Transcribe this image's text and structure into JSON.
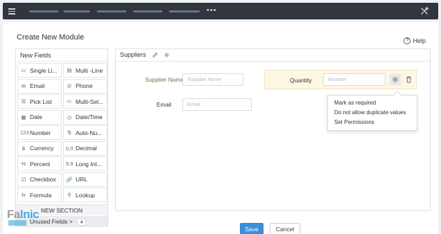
{
  "topbar": {
    "more": "•••"
  },
  "page": {
    "title": "Create New Module",
    "help": "Help",
    "help_glyph": "?"
  },
  "fields_panel": {
    "header": "New Fields",
    "items": [
      {
        "label": "Single Li...",
        "icon": "single-line-icon",
        "glyph": "▭"
      },
      {
        "label": "Multi -Line",
        "icon": "multi-line-icon",
        "glyph": "▤"
      },
      {
        "label": "Email",
        "icon": "email-icon",
        "glyph": "✉"
      },
      {
        "label": "Phone",
        "icon": "phone-icon",
        "glyph": "✆"
      },
      {
        "label": "Pick List",
        "icon": "pick-list-icon",
        "glyph": "☰"
      },
      {
        "label": "Multi-Sel...",
        "icon": "multi-select-icon",
        "glyph": "≔"
      },
      {
        "label": "Date",
        "icon": "date-icon",
        "glyph": "▦"
      },
      {
        "label": "Date/Time",
        "icon": "date-time-icon",
        "glyph": "◷"
      },
      {
        "label": "Number",
        "icon": "number-icon",
        "glyph": "123"
      },
      {
        "label": "Auto-Nu...",
        "icon": "auto-number-icon",
        "glyph": "⇅"
      },
      {
        "label": "Currency",
        "icon": "currency-icon",
        "glyph": "$"
      },
      {
        "label": "Decimal",
        "icon": "decimal-icon",
        "glyph": "0.0"
      },
      {
        "label": "Percent",
        "icon": "percent-icon",
        "glyph": "%"
      },
      {
        "label": "Long Int...",
        "icon": "long-integer-icon",
        "glyph": "9.9"
      },
      {
        "label": "Checkbox",
        "icon": "checkbox-icon",
        "glyph": "☑"
      },
      {
        "label": "URL",
        "icon": "url-icon",
        "glyph": "🔗"
      },
      {
        "label": "Formula",
        "icon": "formula-icon",
        "glyph": "fx"
      },
      {
        "label": "Lookup",
        "icon": "lookup-icon",
        "glyph": "⚲"
      }
    ],
    "new_section": "NEW SECTION",
    "unused_label": "Unused Fields",
    "unused_arrow": ">",
    "unused_count": "4"
  },
  "layout": {
    "section_name": "Suppliers",
    "supplier_name": {
      "label": "Supplier Name",
      "required": "*",
      "placeholder": "Supplier Name"
    },
    "email": {
      "label": "Email",
      "placeholder": "Email"
    },
    "quantity": {
      "label": "Quantity",
      "placeholder": "Number"
    },
    "menu": [
      "Mark as required",
      "Do not allow duplicate values",
      "Set Permissions"
    ]
  },
  "actions": {
    "save": "Save",
    "cancel": "Cancel"
  },
  "watermark": {
    "part1": "Fa",
    "part2": "lnic"
  },
  "colors": {
    "topbar": "#2f3640",
    "save": "#3c8ed8",
    "highlight": "#fdf6e3",
    "required_label": "#8a6a3a"
  }
}
